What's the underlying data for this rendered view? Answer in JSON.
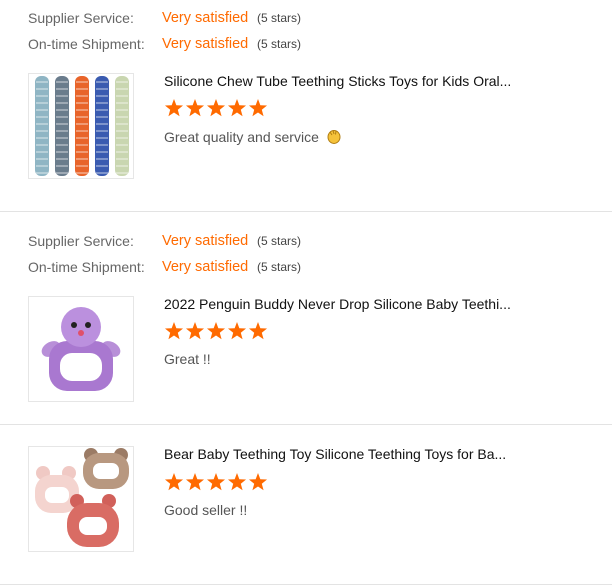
{
  "reviews": [
    {
      "supplier_label": "Supplier Service:",
      "supplier_value": "Very satisfied",
      "supplier_count": "(5 stars)",
      "shipment_label": "On-time Shipment:",
      "shipment_value": "Very satisfied",
      "shipment_count": "(5 stars)",
      "product_title": "Silicone Chew Tube Teething Sticks Toys for Kids Oral...",
      "rating": 5,
      "comment": "Great quality and service",
      "comment_emoji": "clapping-hands-icon"
    },
    {
      "supplier_label": "Supplier Service:",
      "supplier_value": "Very satisfied",
      "supplier_count": "(5 stars)",
      "shipment_label": "On-time Shipment:",
      "shipment_value": "Very satisfied",
      "shipment_count": "(5 stars)",
      "product_title": "2022 Penguin Buddy Never Drop Silicone Baby Teethi...",
      "rating": 5,
      "comment": "Great !!"
    },
    {
      "product_title": "Bear Baby Teething Toy Silicone Teething Toys for Ba...",
      "rating": 5,
      "comment": "Good seller !!"
    }
  ],
  "colors": {
    "accent": "#ff6a00",
    "star": "#ff6a00",
    "divider": "#e3e3e3"
  }
}
